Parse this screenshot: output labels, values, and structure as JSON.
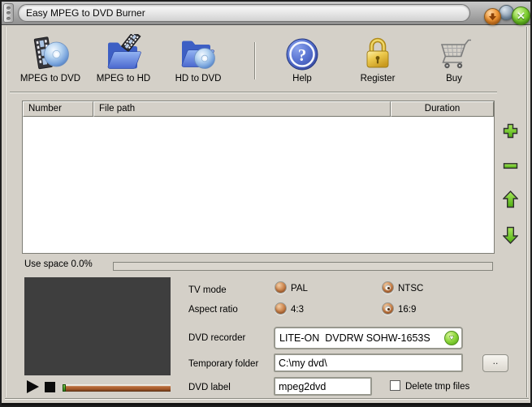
{
  "window": {
    "title": "Easy MPEG to DVD Burner"
  },
  "titlebar": {
    "close_glyph": "✕"
  },
  "toolbar": {
    "items": [
      {
        "label": "MPEG to DVD",
        "icon": "film-disc-icon"
      },
      {
        "label": "MPEG to HD",
        "icon": "folder-film-icon"
      },
      {
        "label": "HD to DVD",
        "icon": "folder-disc-icon"
      },
      {
        "label": "Help",
        "icon": "help-icon"
      },
      {
        "label": "Register",
        "icon": "padlock-icon"
      },
      {
        "label": "Buy",
        "icon": "cart-icon"
      }
    ]
  },
  "file_list": {
    "columns": [
      "Number",
      "File path",
      "Duration"
    ],
    "rows": []
  },
  "list_controls": {
    "add": "plus-icon",
    "remove": "minus-icon",
    "move_up": "arrow-up-icon",
    "move_down": "arrow-down-icon"
  },
  "usage": {
    "label": "Use space 0.0%",
    "percent": 0
  },
  "player": {
    "position_percent": 0
  },
  "settings": {
    "tv_mode": {
      "label": "TV mode",
      "options": [
        {
          "label": "PAL",
          "selected": false
        },
        {
          "label": "NTSC",
          "selected": true
        }
      ]
    },
    "aspect_ratio": {
      "label": "Aspect ratio",
      "options": [
        {
          "label": "4:3",
          "selected": false
        },
        {
          "label": "16:9",
          "selected": true
        }
      ]
    },
    "dvd_recorder": {
      "label": "DVD recorder",
      "value": "LITE-ON  DVDRW SOHW-1653S"
    },
    "temporary_folder": {
      "label": "Temporary folder",
      "value": "C:\\my dvd\\",
      "browse_label": ".."
    },
    "dvd_label": {
      "label": "DVD label",
      "value": "mpeg2dvd"
    },
    "delete_tmp_files": {
      "label": "Delete tmp files",
      "checked": false
    }
  },
  "colors": {
    "window_bg": "#d4d0c8",
    "accent_green": "#5cc41e",
    "radio_copper": "#c67945",
    "slider_track": "#a65a2b",
    "preview_bg": "#3e3e3e",
    "minimize_orange": "#ef9838",
    "maximize_gray": "#97a9bb",
    "close_green": "#7fcf33"
  }
}
